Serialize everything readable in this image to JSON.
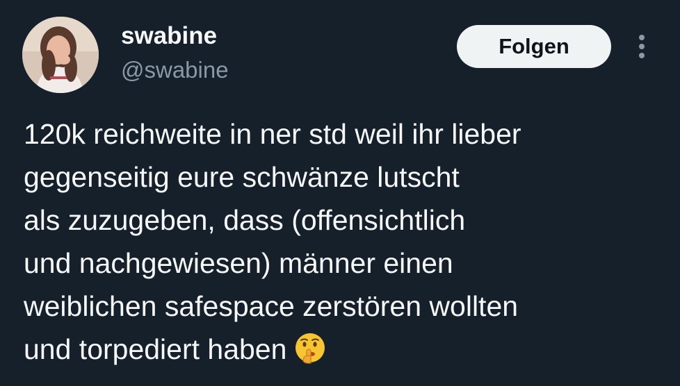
{
  "user": {
    "display_name": "swabine",
    "handle": "@swabine"
  },
  "actions": {
    "follow_label": "Folgen",
    "more_icon": "more-vertical-icon"
  },
  "tweet": {
    "lines": [
      "120k reichweite in ner std weil ihr lieber",
      "gegenseitig eure schwänze lutscht",
      "als zuzugeben, dass (offensichtlich",
      "und nachgewiesen) männer einen",
      "weiblichen safespace zerstören wollten",
      "und torpediert haben"
    ],
    "emoji": "shushing-face-emoji"
  },
  "colors": {
    "background": "#15202b",
    "text_primary": "#f7f9f9",
    "text_secondary": "#8b98a5",
    "button_bg": "#eff3f4",
    "button_text": "#0f1419"
  }
}
